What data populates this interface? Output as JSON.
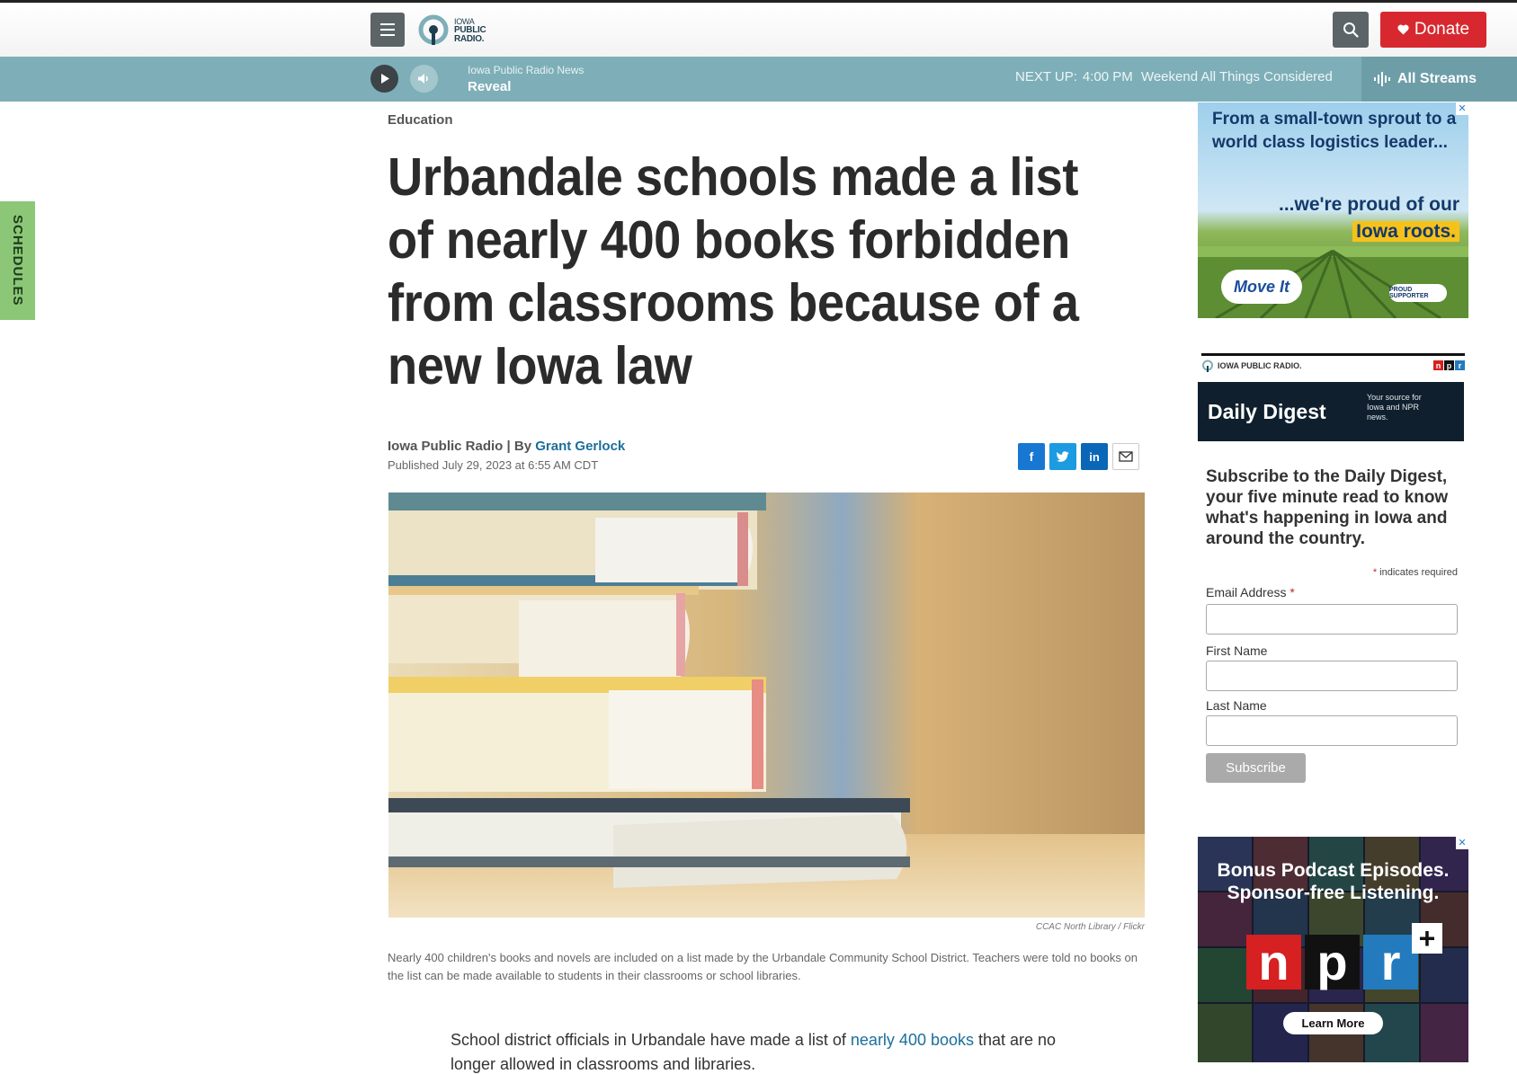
{
  "header": {
    "logo_lines": [
      "IOWA",
      "PUBLIC",
      "RADIO."
    ],
    "donate_label": "Donate"
  },
  "player": {
    "station": "Iowa Public Radio News",
    "show": "Reveal",
    "next_up_label": "NEXT UP:",
    "next_up_time": "4:00 PM",
    "next_up_show": "Weekend All Things Considered",
    "all_streams_label": "All Streams"
  },
  "schedules_tab": "SCHEDULES",
  "article": {
    "section": "Education",
    "headline": "Urbandale schools made a list of nearly 400 books forbidden from classrooms because of a new Iowa law",
    "byline_prefix": "Iowa Public Radio | By ",
    "author": "Grant Gerlock",
    "published": "Published July 29, 2023 at 6:55 AM CDT",
    "share": {
      "facebook": "f",
      "twitter": "t",
      "linkedin": "in"
    },
    "image_credit": "CCAC North Library  /  Flickr",
    "caption": "Nearly 400 children's books and novels are included on a list made by the Urbandale Community School District. Teachers were told no books on the list can be made available to students in their classrooms or school libraries.",
    "body_before_link": "School district officials in Urbandale have made a list of ",
    "body_link": "nearly 400 books",
    "body_after_link": " that are no longer allowed in classrooms and libraries."
  },
  "sidebar": {
    "ad1": {
      "close": "✕",
      "line1": "From a small-town sprout  to a world class logistics leader...",
      "line2a": "...we're proud of our",
      "line2b": "Iowa roots.",
      "brand": "Move It",
      "badge": "PROUD SUPPORTER"
    },
    "digest": {
      "ipr_label": "IOWA PUBLIC RADIO.",
      "npr_letters": [
        "n",
        "p",
        "r"
      ],
      "title": "Daily Digest",
      "subtitle": "Your source for Iowa and NPR news.",
      "heading": "Subscribe to the Daily Digest, your five minute read to know what's happening in Iowa and around the country.",
      "required_star": "*",
      "required_note": " indicates required",
      "email_label": "Email Address",
      "first_name_label": "First Name",
      "last_name_label": "Last Name",
      "email_value": "",
      "first_name_value": "",
      "last_name_value": "",
      "subscribe_label": "Subscribe"
    },
    "ad2": {
      "close": "✕",
      "headline_line1": "Bonus Podcast Episodes.",
      "headline_line2": "Sponsor-free Listening.",
      "npr_letters": [
        "n",
        "p",
        "r"
      ],
      "plus": "+",
      "cta": "Learn More"
    }
  },
  "colors": {
    "player_bar": "#7eafb8",
    "donate": "#d8282f",
    "link": "#1a6f9c",
    "schedules_tab": "#8bc776",
    "npr_red": "#d62021",
    "npr_black": "#111111",
    "npr_blue": "#237bbd"
  }
}
